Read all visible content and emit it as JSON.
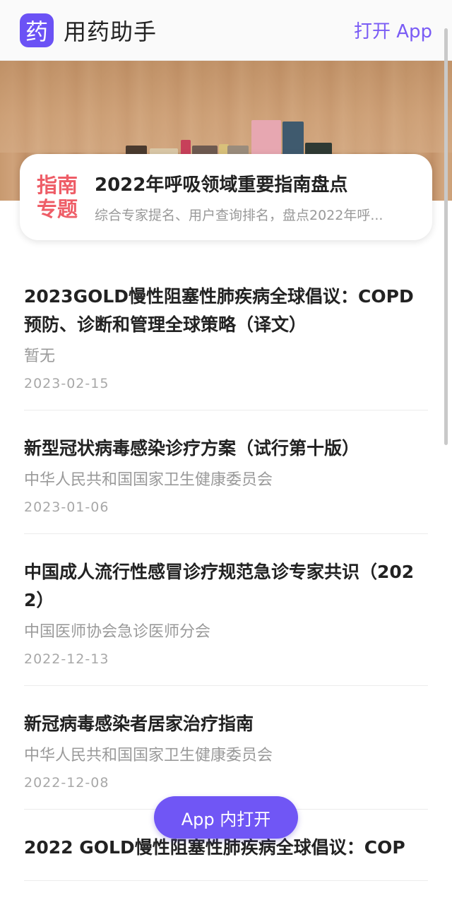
{
  "header": {
    "logo_char": "药",
    "app_name": "用药助手",
    "open_app": "打开 App"
  },
  "banner": {
    "tag_line1": "指南",
    "tag_line2": "专题",
    "title": "2022年呼吸领域重要指南盘点",
    "desc": "综合专家提名、用户查询排名，盘点2022年呼..."
  },
  "items": [
    {
      "title": "2023GOLD慢性阻塞性肺疾病全球倡议：COPD预防、诊断和管理全球策略（译文）",
      "source": "暂无",
      "date": "2023-02-15"
    },
    {
      "title": "新型冠状病毒感染诊疗方案（试行第十版）",
      "source": "中华人民共和国国家卫生健康委员会",
      "date": "2023-01-06"
    },
    {
      "title": "中国成人流行性感冒诊疗规范急诊专家共识（2022）",
      "source": "中国医师协会急诊医师分会",
      "date": "2022-12-13"
    },
    {
      "title": "新冠病毒感染者居家治疗指南",
      "source": "中华人民共和国国家卫生健康委员会",
      "date": "2022-12-08"
    },
    {
      "title": "2022 GOLD慢性阻塞性肺疾病全球倡议：COP",
      "source": "",
      "date": ""
    }
  ],
  "float_button": "App 内打开",
  "colors": {
    "accent": "#6b52f5",
    "tag": "#ee5d67"
  }
}
